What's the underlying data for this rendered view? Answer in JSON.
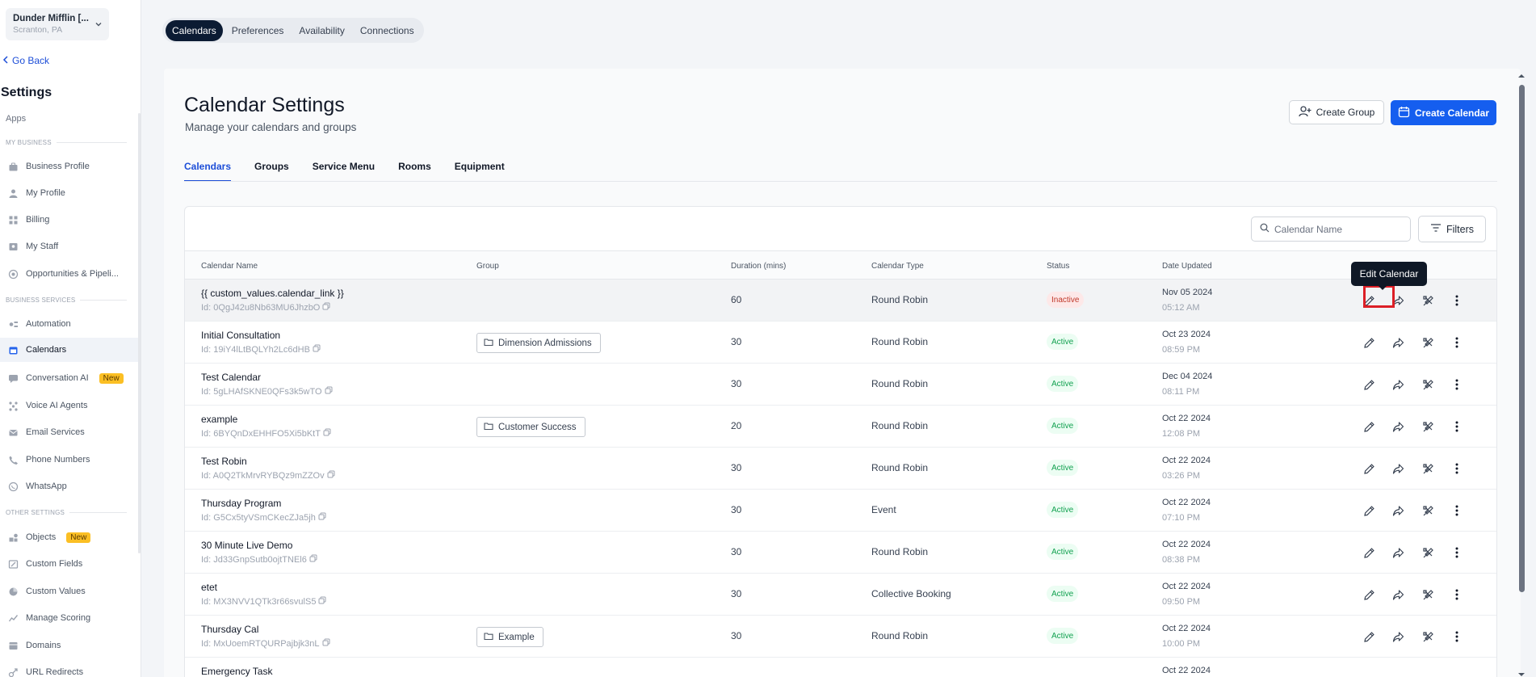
{
  "location": {
    "name": "Dunder Mifflin [...",
    "sub": "Scranton, PA"
  },
  "sidebar": {
    "go_back": "Go Back",
    "title": "Settings",
    "apps": "Apps",
    "sections": [
      "MY BUSINESS",
      "BUSINESS SERVICES",
      "OTHER SETTINGS"
    ],
    "items": [
      {
        "label": "Business Profile",
        "icon": "briefcase-icon"
      },
      {
        "label": "My Profile",
        "icon": "user-icon"
      },
      {
        "label": "Billing",
        "icon": "grid-icon"
      },
      {
        "label": "My Staff",
        "icon": "staff-icon"
      },
      {
        "label": "Opportunities & Pipeli...",
        "icon": "target-icon"
      },
      {
        "label": "Automation",
        "icon": "automation-icon"
      },
      {
        "label": "Calendars",
        "icon": "calendar-icon"
      },
      {
        "label": "Conversation AI",
        "icon": "chat-icon",
        "badge": "New"
      },
      {
        "label": "Voice AI Agents",
        "icon": "voice-icon"
      },
      {
        "label": "Email Services",
        "icon": "email-icon"
      },
      {
        "label": "Phone Numbers",
        "icon": "phone-icon"
      },
      {
        "label": "WhatsApp",
        "icon": "whatsapp-icon"
      },
      {
        "label": "Objects",
        "icon": "objects-icon",
        "badge": "New"
      },
      {
        "label": "Custom Fields",
        "icon": "custom-fields-icon"
      },
      {
        "label": "Custom Values",
        "icon": "custom-values-icon"
      },
      {
        "label": "Manage Scoring",
        "icon": "scoring-icon"
      },
      {
        "label": "Domains",
        "icon": "domains-icon"
      },
      {
        "label": "URL Redirects",
        "icon": "redirect-icon"
      }
    ]
  },
  "topnav": [
    "Calendars",
    "Preferences",
    "Availability",
    "Connections"
  ],
  "page": {
    "title": "Calendar Settings",
    "subtitle": "Manage your calendars and groups",
    "create_group": "Create Group",
    "create_calendar": "Create Calendar"
  },
  "tabs": [
    "Calendars",
    "Groups",
    "Service Menu",
    "Rooms",
    "Equipment"
  ],
  "search": {
    "placeholder": "Calendar Name"
  },
  "filters_label": "Filters",
  "table": {
    "headers": [
      "Calendar Name",
      "Group",
      "Duration (mins)",
      "Calendar Type",
      "Status",
      "Date Updated"
    ],
    "rows": [
      {
        "name": "{{ custom_values.calendar_link }}",
        "id": "Id: 0QgJ42u8Nb63MU6JhzbO",
        "group": "",
        "duration": "60",
        "type": "Round Robin",
        "status": "Inactive",
        "date": "Nov 05 2024",
        "time": "05:12 AM"
      },
      {
        "name": "Initial Consultation",
        "id": "Id: 19iY4lLtBQLYh2Lc6dHB",
        "group": "Dimension Admissions",
        "duration": "30",
        "type": "Round Robin",
        "status": "Active",
        "date": "Oct 23 2024",
        "time": "08:59 PM"
      },
      {
        "name": "Test Calendar",
        "id": "Id: 5gLHAfSKNE0QFs3k5wTO",
        "group": "",
        "duration": "30",
        "type": "Round Robin",
        "status": "Active",
        "date": "Dec 04 2024",
        "time": "08:11 PM"
      },
      {
        "name": "example",
        "id": "Id: 6BYQnDxEHHFO5Xi5bKtT",
        "group": "Customer Success",
        "duration": "20",
        "type": "Round Robin",
        "status": "Active",
        "date": "Oct 22 2024",
        "time": "12:08 PM"
      },
      {
        "name": "Test Robin",
        "id": "Id: A0Q2TkMrvRYBQz9mZZOv",
        "group": "",
        "duration": "30",
        "type": "Round Robin",
        "status": "Active",
        "date": "Oct 22 2024",
        "time": "03:26 PM"
      },
      {
        "name": "Thursday Program",
        "id": "Id: G5Cx5tyVSmCKecZJa5jh",
        "group": "",
        "duration": "30",
        "type": "Event",
        "status": "Active",
        "date": "Oct 22 2024",
        "time": "07:10 PM"
      },
      {
        "name": "30 Minute Live Demo",
        "id": "Id: Jd33GnpSutb0ojtTNEl6",
        "group": "",
        "duration": "30",
        "type": "Round Robin",
        "status": "Active",
        "date": "Oct 22 2024",
        "time": "08:38 PM"
      },
      {
        "name": "etet",
        "id": "Id: MX3NVV1QTk3r66svulS5",
        "group": "",
        "duration": "30",
        "type": "Collective Booking",
        "status": "Active",
        "date": "Oct 22 2024",
        "time": "09:50 PM"
      },
      {
        "name": "Thursday Cal",
        "id": "Id: MxUoemRTQURPajbjk3nL",
        "group": "Example",
        "duration": "30",
        "type": "Round Robin",
        "status": "Active",
        "date": "Oct 22 2024",
        "time": "10:00 PM"
      },
      {
        "name": "Emergency Task",
        "id": "",
        "group": "",
        "duration": "",
        "type": "",
        "status": "",
        "date": "Oct 22 2024",
        "time": ""
      }
    ]
  },
  "tooltip": "Edit Calendar",
  "colors": {
    "accent": "#155eef",
    "active": "#12a150",
    "inactive": "#c0392b",
    "highlight": "#dc1f26"
  }
}
